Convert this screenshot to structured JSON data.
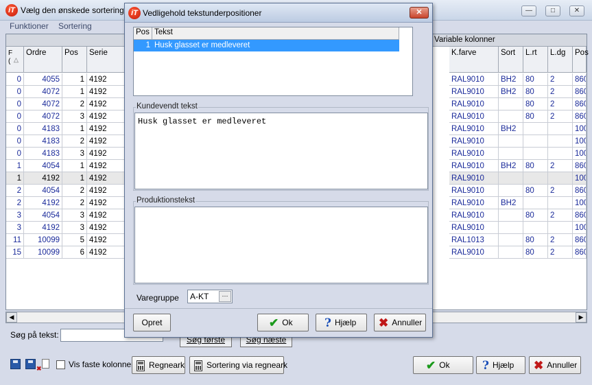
{
  "main": {
    "title": "Vælg den ønskede sortering f",
    "menu": [
      "Funktioner",
      "Sortering"
    ],
    "variable_columns_label": "Variable kolonner",
    "columns_left": [
      "F\n(",
      "Ordre",
      "Pos",
      "Serie"
    ],
    "columns_right": [
      "K.farve",
      "Sort",
      "L.rt",
      "L.dg",
      "Pos"
    ],
    "rows": [
      {
        "f": "0",
        "ordre": "4055",
        "pos": "1",
        "serie": "4192",
        "kfarve": "RAL9010",
        "sort": "BH2",
        "lrt": "80",
        "ldg": "2",
        "pos2": "860"
      },
      {
        "f": "0",
        "ordre": "4072",
        "pos": "1",
        "serie": "4192",
        "kfarve": "RAL9010",
        "sort": "BH2",
        "lrt": "80",
        "ldg": "2",
        "pos2": "860"
      },
      {
        "f": "0",
        "ordre": "4072",
        "pos": "2",
        "serie": "4192",
        "kfarve": "RAL9010",
        "sort": "",
        "lrt": "80",
        "ldg": "2",
        "pos2": "860"
      },
      {
        "f": "0",
        "ordre": "4072",
        "pos": "3",
        "serie": "4192",
        "kfarve": "RAL9010",
        "sort": "",
        "lrt": "80",
        "ldg": "2",
        "pos2": "860"
      },
      {
        "f": "0",
        "ordre": "4183",
        "pos": "1",
        "serie": "4192",
        "kfarve": "RAL9010",
        "sort": "BH2",
        "lrt": "",
        "ldg": "",
        "pos2": "100"
      },
      {
        "f": "0",
        "ordre": "4183",
        "pos": "2",
        "serie": "4192",
        "kfarve": "RAL9010",
        "sort": "",
        "lrt": "",
        "ldg": "",
        "pos2": "100"
      },
      {
        "f": "0",
        "ordre": "4183",
        "pos": "3",
        "serie": "4192",
        "kfarve": "RAL9010",
        "sort": "",
        "lrt": "",
        "ldg": "",
        "pos2": "100"
      },
      {
        "f": "1",
        "ordre": "4054",
        "pos": "1",
        "serie": "4192",
        "kfarve": "RAL9010",
        "sort": "BH2",
        "lrt": "80",
        "ldg": "2",
        "pos2": "860"
      },
      {
        "f": "1",
        "ordre": "4192",
        "pos": "1",
        "serie": "4192",
        "kfarve": "RAL9010",
        "sort": "",
        "lrt": "",
        "ldg": "",
        "pos2": "100"
      },
      {
        "f": "2",
        "ordre": "4054",
        "pos": "2",
        "serie": "4192",
        "kfarve": "RAL9010",
        "sort": "",
        "lrt": "80",
        "ldg": "2",
        "pos2": "860"
      },
      {
        "f": "2",
        "ordre": "4192",
        "pos": "2",
        "serie": "4192",
        "kfarve": "RAL9010",
        "sort": "BH2",
        "lrt": "",
        "ldg": "",
        "pos2": "100"
      },
      {
        "f": "3",
        "ordre": "4054",
        "pos": "3",
        "serie": "4192",
        "kfarve": "RAL9010",
        "sort": "",
        "lrt": "80",
        "ldg": "2",
        "pos2": "860"
      },
      {
        "f": "3",
        "ordre": "4192",
        "pos": "3",
        "serie": "4192",
        "kfarve": "RAL9010",
        "sort": "",
        "lrt": "",
        "ldg": "",
        "pos2": "100"
      },
      {
        "f": "11",
        "ordre": "10099",
        "pos": "5",
        "serie": "4192",
        "kfarve": "RAL1013",
        "sort": "",
        "lrt": "80",
        "ldg": "2",
        "pos2": "860"
      },
      {
        "f": "15",
        "ordre": "10099",
        "pos": "6",
        "serie": "4192",
        "kfarve": "RAL9010",
        "sort": "",
        "lrt": "80",
        "ldg": "2",
        "pos2": "860"
      }
    ],
    "selected_row": 8,
    "search_label": "Søg på tekst:",
    "search_value": "",
    "search_first_label": "Søg første",
    "search_next_label": "Søg næste",
    "show_fixed_columns_label": "Vis faste kolonner",
    "spreadsheet_label": "Regneark",
    "sort_via_spreadsheet_label": "Sortering via regneark",
    "ok_label": "Ok",
    "help_label": "Hjælp",
    "cancel_label": "Annuller"
  },
  "dialog": {
    "title": "Vedligehold tekstunderpositioner",
    "list_headers": [
      "Pos",
      "Tekst"
    ],
    "list_rows": [
      {
        "pos": "1",
        "text": "Husk glasset er medleveret"
      }
    ],
    "customer_text_label": "Kundevendt tekst",
    "customer_text_value": "Husk glasset er medleveret",
    "production_text_label": "Produktionstekst",
    "production_text_value": "",
    "product_group_label": "Varegruppe",
    "product_group_value": "A-KT",
    "create_label": "Opret",
    "ok_label": "Ok",
    "help_label": "Hjælp",
    "cancel_label": "Annuller"
  },
  "colors": {
    "grid_text": "#1a2a9a",
    "selection": "#3399ff",
    "accent_ok": "#1c9a1c",
    "accent_cancel": "#c01818"
  }
}
